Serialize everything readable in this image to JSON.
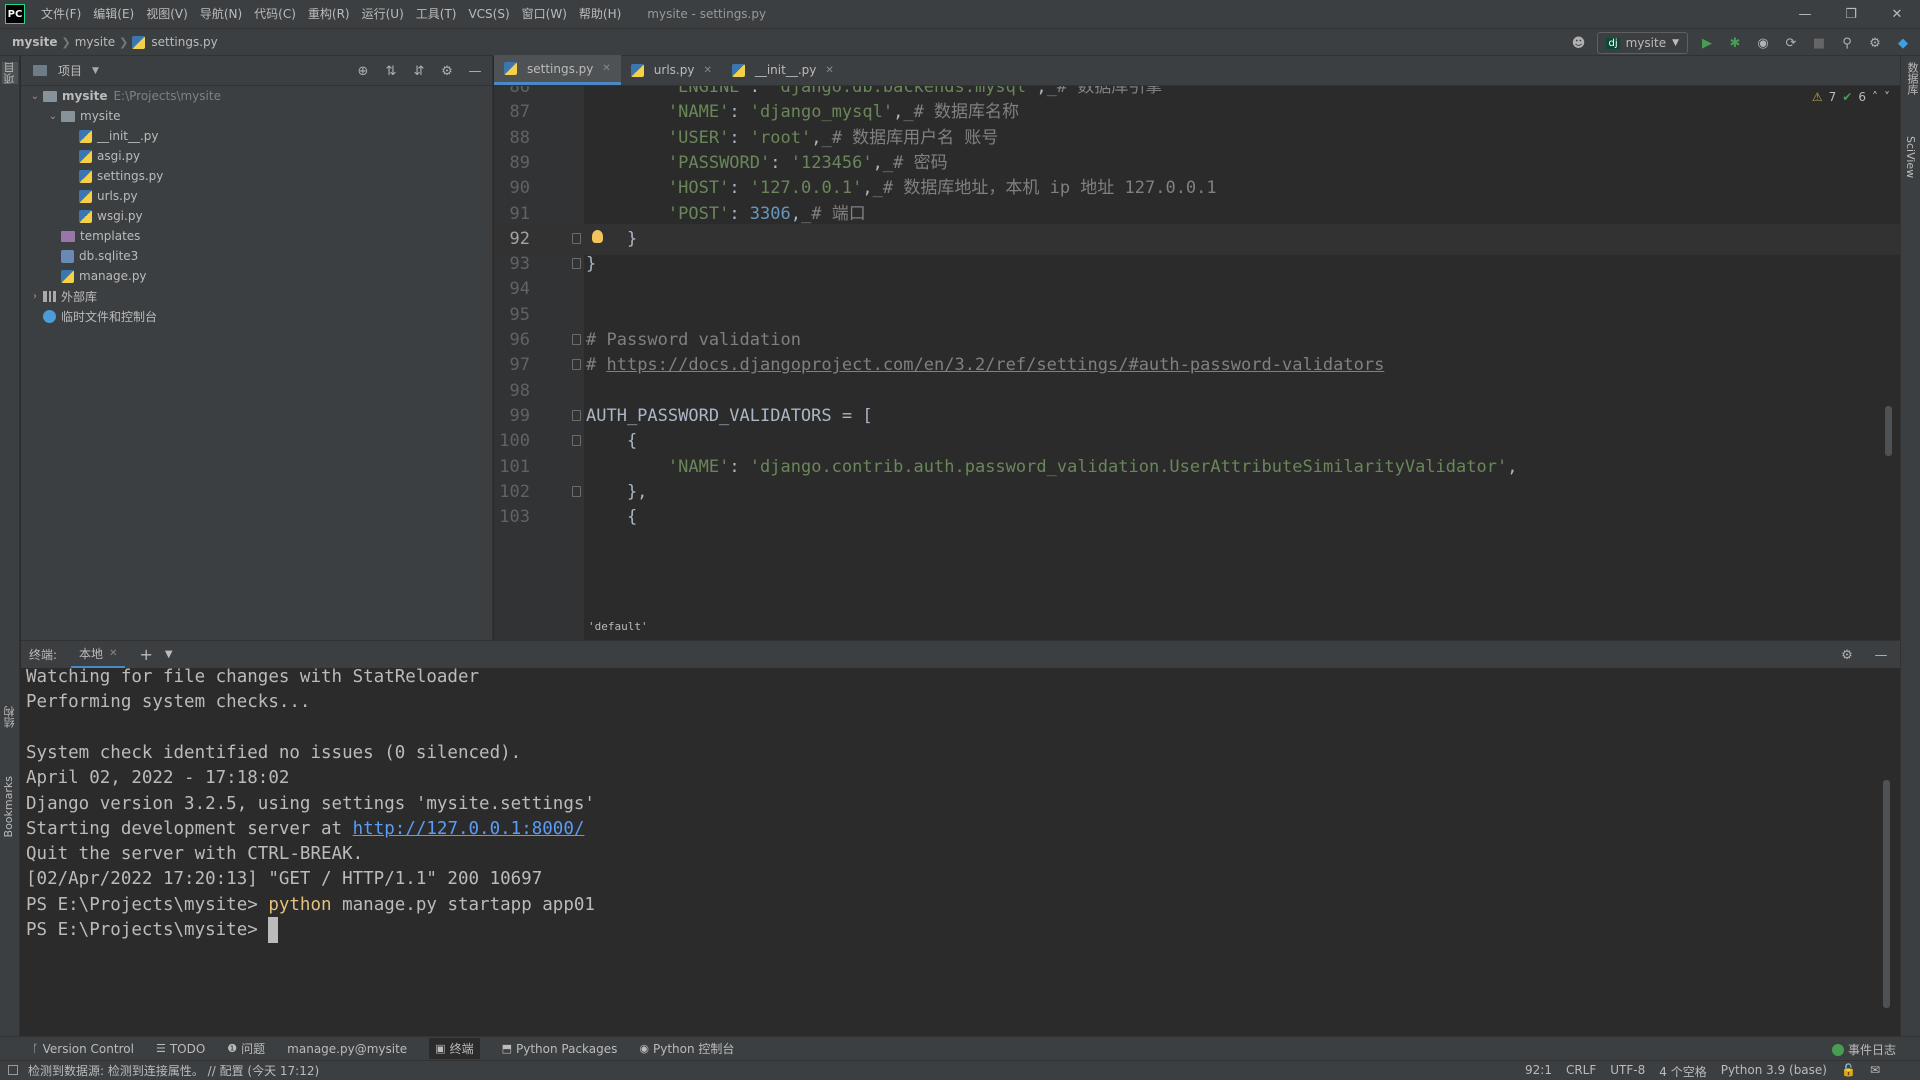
{
  "menubar": {
    "logo": "PC",
    "items": [
      "文件(F)",
      "编辑(E)",
      "视图(V)",
      "导航(N)",
      "代码(C)",
      "重构(R)",
      "运行(U)",
      "工具(T)",
      "VCS(S)",
      "窗口(W)",
      "帮助(H)"
    ],
    "window_title": "mysite - settings.py"
  },
  "navbar": {
    "crumbs": [
      "mysite",
      "mysite",
      "settings.py"
    ],
    "run_config": "mysite"
  },
  "project": {
    "title": "项目",
    "tree": [
      {
        "label": "mysite",
        "path": "E:\\Projects\\mysite",
        "depth": 0,
        "expanded": true,
        "type": "folder",
        "bold": true
      },
      {
        "label": "mysite",
        "depth": 1,
        "expanded": true,
        "type": "folder"
      },
      {
        "label": "__init__.py",
        "depth": 2,
        "type": "py"
      },
      {
        "label": "asgi.py",
        "depth": 2,
        "type": "py"
      },
      {
        "label": "settings.py",
        "depth": 2,
        "type": "py"
      },
      {
        "label": "urls.py",
        "depth": 2,
        "type": "py"
      },
      {
        "label": "wsgi.py",
        "depth": 2,
        "type": "py"
      },
      {
        "label": "templates",
        "depth": 1,
        "type": "folder-purple"
      },
      {
        "label": "db.sqlite3",
        "depth": 1,
        "type": "db"
      },
      {
        "label": "manage.py",
        "depth": 1,
        "type": "py"
      },
      {
        "label": "外部库",
        "depth": 0,
        "expanded": false,
        "type": "lib"
      },
      {
        "label": "临时文件和控制台",
        "depth": 0,
        "type": "scratch"
      }
    ]
  },
  "editor": {
    "tabs": [
      {
        "label": "settings.py",
        "active": true
      },
      {
        "label": "urls.py",
        "active": false
      },
      {
        "label": "__init__.py",
        "active": false
      }
    ],
    "inspections": {
      "warnings": "7",
      "ok": "6"
    },
    "breadcrumb": "'default'",
    "lines": [
      {
        "n": "86",
        "html": "        <span class=\"s\">'ENGINE'</span>: <span class=\"s\">'django.db.backends.mysql'</span>,<span class=\"c\">_# 数据库引擎</span>"
      },
      {
        "n": "87",
        "html": "        <span class=\"s\">'NAME'</span>: <span class=\"s\">'django_mysql'</span>,<span class=\"c\">_# 数据库名称</span>"
      },
      {
        "n": "88",
        "html": "        <span class=\"s\">'USER'</span>: <span class=\"s\">'root'</span>,<span class=\"c\">_# 数据库用户名 账号</span>"
      },
      {
        "n": "89",
        "html": "        <span class=\"s\">'PASSWORD'</span>: <span class=\"s\">'123456'</span>,<span class=\"c\">_# 密码</span>"
      },
      {
        "n": "90",
        "html": "        <span class=\"s\">'HOST'</span>: <span class=\"s\">'127.0.0.1'</span>,<span class=\"c\">_# 数据库地址，本机 ip 地址 127.0.0.1</span>"
      },
      {
        "n": "91",
        "html": "        <span class=\"s\">'POST'</span>: <span class=\"n\">3306</span>,<span class=\"c\">_# 端口</span>"
      },
      {
        "n": "92",
        "html": "    }",
        "current": true
      },
      {
        "n": "93",
        "html": "}"
      },
      {
        "n": "94",
        "html": ""
      },
      {
        "n": "95",
        "html": ""
      },
      {
        "n": "96",
        "html": "<span class=\"c\"># Password validation</span>"
      },
      {
        "n": "97",
        "html": "<span class=\"c\"># </span><span class=\"u\">https://docs.djangoproject.com/en/3.2/ref/settings/#auth-password-validators</span>"
      },
      {
        "n": "98",
        "html": ""
      },
      {
        "n": "99",
        "html": "AUTH_PASSWORD_VALIDATORS = ["
      },
      {
        "n": "100",
        "html": "    {"
      },
      {
        "n": "101",
        "html": "        <span class=\"s\">'NAME'</span>: <span class=\"s\">'django.contrib.auth.password_validation.UserAttributeSimilarityValidator'</span>,"
      },
      {
        "n": "102",
        "html": "    },"
      },
      {
        "n": "103",
        "html": "    {"
      }
    ]
  },
  "terminal": {
    "title": "终端:",
    "tab": "本地",
    "lines": [
      {
        "text": "Watching for file changes with StatReloader"
      },
      {
        "text": "Performing system checks..."
      },
      {
        "text": ""
      },
      {
        "text": "System check identified no issues (0 silenced)."
      },
      {
        "text": "April 02, 2022 - 17:18:02"
      },
      {
        "text": "Django version 3.2.5, using settings 'mysite.settings'"
      },
      {
        "text": "Starting development server at ",
        "link": "http://127.0.0.1:8000/"
      },
      {
        "text": "Quit the server with CTRL-BREAK."
      },
      {
        "text": "[02/Apr/2022 17:20:13] \"GET / HTTP/1.1\" 200 10697"
      },
      {
        "prompt": "PS E:\\Projects\\mysite> ",
        "cmd": "python",
        "rest": " manage.py startapp app01"
      },
      {
        "prompt": "PS E:\\Projects\\mysite> ",
        "cursor": true
      }
    ]
  },
  "left_strip": {
    "project": "项目",
    "structure": "结构",
    "bookmarks": "Bookmarks"
  },
  "right_strip": {
    "database": "数据库",
    "sciview": "SciView"
  },
  "toolwindows": {
    "items": [
      "Version Control",
      "TODO",
      "问题",
      "manage.py@mysite",
      "终端",
      "Python Packages",
      "Python 控制台"
    ],
    "active": "终端",
    "event_log": "事件日志"
  },
  "status": {
    "message": "检测到数据源: 检测到连接属性。 // 配置 (今天 17:12)",
    "position": "92:1",
    "line_sep": "CRLF",
    "encoding": "UTF-8",
    "indent": "4 个空格",
    "interpreter": "Python 3.9 (base)"
  }
}
